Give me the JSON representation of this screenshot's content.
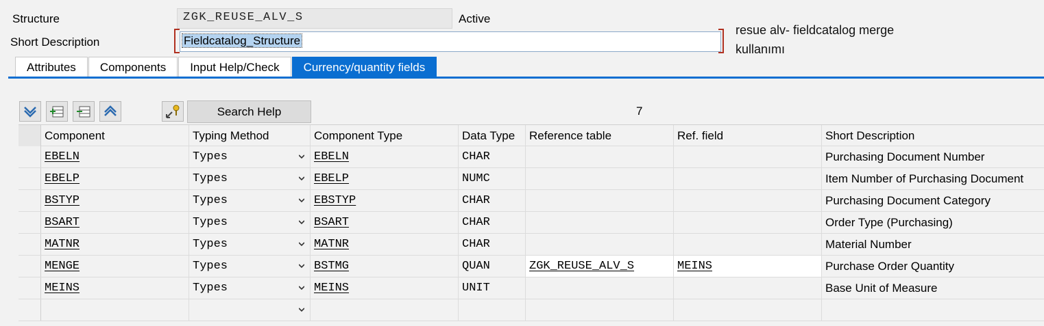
{
  "header": {
    "structure_label": "Structure",
    "structure_value": "ZGK_REUSE_ALV_S",
    "status": "Active",
    "short_desc_label": "Short Description",
    "short_desc_value": "Fieldcatalog_Structure"
  },
  "note": "resue alv- fieldcatalog merge kullanımı",
  "tabs": [
    {
      "label": "Attributes",
      "active": false
    },
    {
      "label": "Components",
      "active": false
    },
    {
      "label": "Input Help/Check",
      "active": false
    },
    {
      "label": "Currency/quantity fields",
      "active": true
    }
  ],
  "toolbar": {
    "icons": [
      "expand-down-icon",
      "insert-row-icon",
      "delete-row-icon",
      "collapse-up-icon",
      "hierarchy-key-icon"
    ],
    "search_help_label": "Search Help",
    "row_count": "7"
  },
  "table": {
    "columns": [
      "Component",
      "Typing Method",
      "Component Type",
      "Data Type",
      "Reference table",
      "Ref. field",
      "Short Description"
    ],
    "rows": [
      {
        "component": "EBELN",
        "typing": "Types",
        "comp_type": "EBELN",
        "data_type": "CHAR",
        "ref_table": "",
        "ref_field": "",
        "desc": "Purchasing Document Number"
      },
      {
        "component": "EBELP",
        "typing": "Types",
        "comp_type": "EBELP",
        "data_type": "NUMC",
        "ref_table": "",
        "ref_field": "",
        "desc": "Item Number of Purchasing Document"
      },
      {
        "component": "BSTYP",
        "typing": "Types",
        "comp_type": "EBSTYP",
        "data_type": "CHAR",
        "ref_table": "",
        "ref_field": "",
        "desc": "Purchasing Document Category"
      },
      {
        "component": "BSART",
        "typing": "Types",
        "comp_type": "BSART",
        "data_type": "CHAR",
        "ref_table": "",
        "ref_field": "",
        "desc": "Order Type (Purchasing)"
      },
      {
        "component": "MATNR",
        "typing": "Types",
        "comp_type": "MATNR",
        "data_type": "CHAR",
        "ref_table": "",
        "ref_field": "",
        "desc": "Material Number"
      },
      {
        "component": "MENGE",
        "typing": "Types",
        "comp_type": "BSTMG",
        "data_type": "QUAN",
        "ref_table": "ZGK_REUSE_ALV_S",
        "ref_field": "MEINS",
        "desc": "Purchase Order Quantity"
      },
      {
        "component": "MEINS",
        "typing": "Types",
        "comp_type": "MEINS",
        "data_type": "UNIT",
        "ref_table": "",
        "ref_field": "",
        "desc": "Base Unit of Measure"
      },
      {
        "component": "",
        "typing": "",
        "comp_type": "",
        "data_type": "",
        "ref_table": "",
        "ref_field": "",
        "desc": ""
      }
    ]
  },
  "colors": {
    "accent": "#0a6ed1",
    "bracket": "#b03020",
    "background": "#f2f2f2"
  }
}
